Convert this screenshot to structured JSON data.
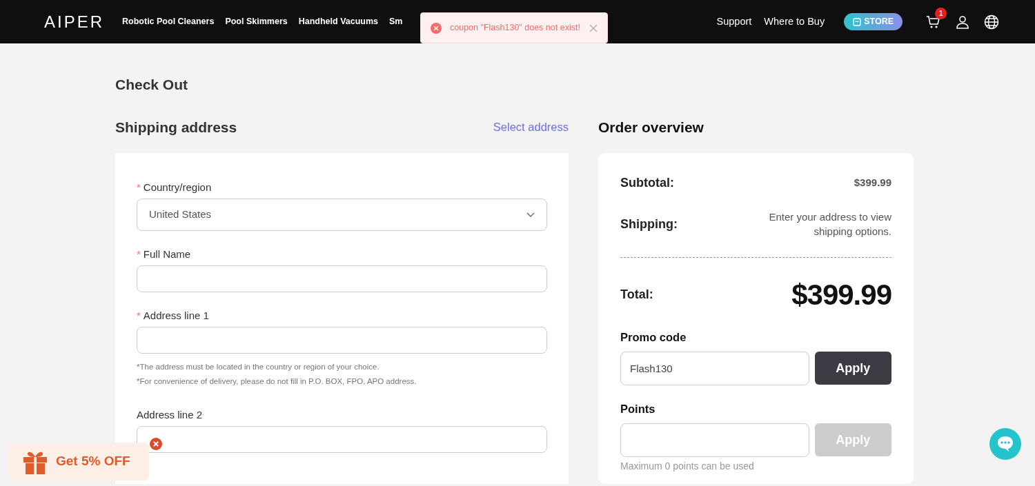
{
  "header": {
    "logo": "AIPER",
    "links": [
      "Robotic Pool Cleaners",
      "Pool Skimmers",
      "Handheld Vacuums",
      "Sm"
    ],
    "right_links": [
      "Support",
      "Where to Buy"
    ],
    "store_button": "STORE",
    "cart_count": "1"
  },
  "toast": {
    "message": "coupon \"Flash130\" does not exist!"
  },
  "page_title": "Check Out",
  "shipping": {
    "title": "Shipping address",
    "select_link": "Select address",
    "fields": [
      {
        "label": "Country/region",
        "marker": "*",
        "kind": "select",
        "value": "United States"
      },
      {
        "label": "Full Name",
        "marker": "*",
        "kind": "input"
      },
      {
        "label": "Address line 1",
        "marker": "*",
        "kind": "input",
        "notes": [
          "*The address must be located in the country or region of your choice.",
          "*For convenience of delivery, please do not fill in P.O. BOX, FPO, APO address."
        ]
      },
      {
        "label": "Address line 2",
        "kind": "input"
      }
    ]
  },
  "order": {
    "title": "Order overview",
    "rows": [
      {
        "label": "Subtotal:",
        "value": "$399.99"
      },
      {
        "label": "Shipping:",
        "value": "Enter your address to view shipping options."
      }
    ],
    "total": {
      "label": "Total:",
      "value": "$399.99"
    },
    "codes": [
      {
        "label": "Promo code",
        "value": "Flash130",
        "button": "Apply",
        "disabled": false
      },
      {
        "label": "Points",
        "button": "Apply",
        "disabled": true,
        "note": "Maximum 0 points can be used"
      }
    ]
  },
  "gift": {
    "label": "Get 5% OFF"
  }
}
